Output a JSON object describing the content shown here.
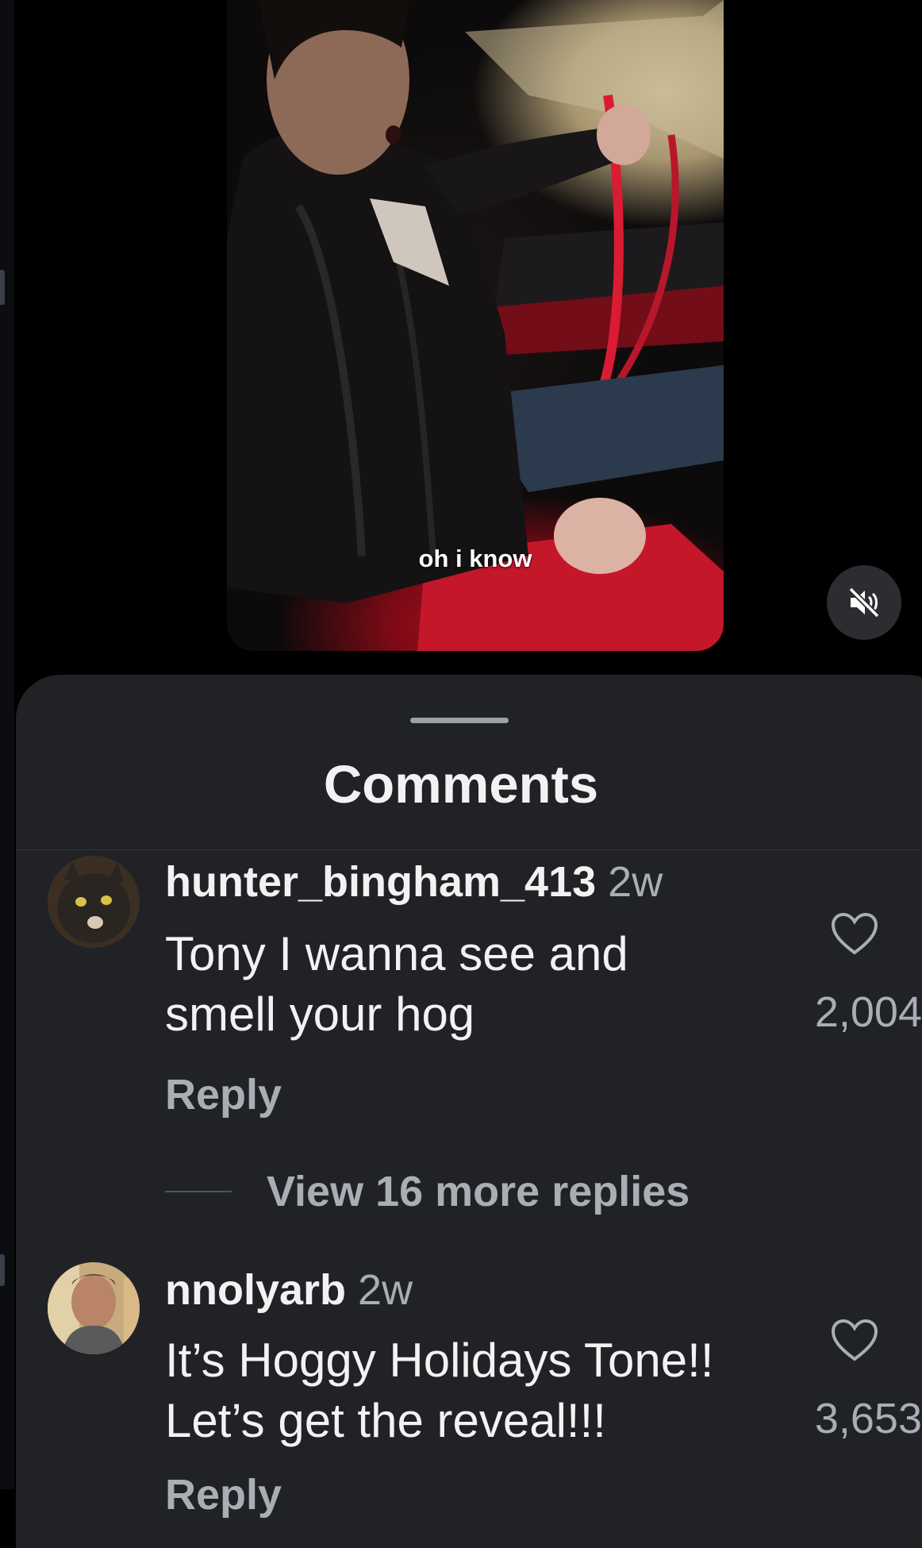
{
  "video": {
    "caption": "oh i know",
    "mute_icon": "speaker-muted-icon"
  },
  "comments_sheet": {
    "title": "Comments",
    "comments": [
      {
        "username": "hunter_bingham_413",
        "time": "2w",
        "text_lines": [
          "Tony I wanna see and",
          "smell your hog"
        ],
        "reply_label": "Reply",
        "likes": "2,004",
        "view_replies_label": "View 16 more replies"
      },
      {
        "username": "nnolyarb",
        "time": "2w",
        "text_lines": [
          "It’s Hoggy Holidays Tone!!",
          "Let’s get the reveal!!!"
        ],
        "reply_label": "Reply",
        "likes": "3,653"
      }
    ]
  },
  "colors": {
    "sheet_background": "#202226",
    "text_primary": "#f2f2f2",
    "text_secondary": "#a9adb4"
  }
}
